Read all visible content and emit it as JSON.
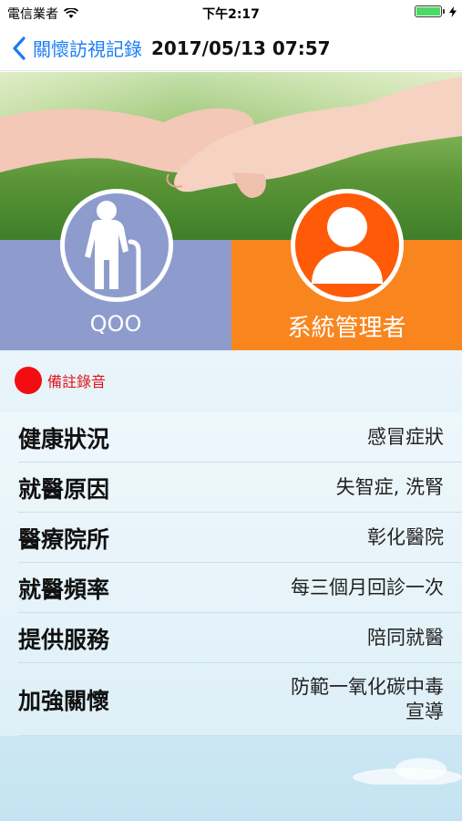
{
  "status_bar": {
    "carrier": "電信業者",
    "time": "下午2:17",
    "wifi_icon": "wifi-icon",
    "battery_color": "#4cd964",
    "battery_level": 1.0
  },
  "nav": {
    "back_label": "關懷訪視記錄",
    "title": "2017/05/13 07:57",
    "accent": "#1a7cf5"
  },
  "profiles": {
    "left": {
      "name": "QOO",
      "icon": "elderly-person-icon",
      "color": "#8d9ccd"
    },
    "right": {
      "name": "系統管理者",
      "icon": "user-icon",
      "color": "#f9851f"
    }
  },
  "record": {
    "label": "備註錄音",
    "color": "#f20d12"
  },
  "info": [
    {
      "key": "健康狀況",
      "value": "感冒症狀"
    },
    {
      "key": "就醫原因",
      "value": "失智症, 洗腎"
    },
    {
      "key": "醫療院所",
      "value": "彰化醫院"
    },
    {
      "key": "就醫頻率",
      "value": "每三個月回診一次"
    },
    {
      "key": "提供服務",
      "value": "陪同就醫"
    },
    {
      "key": "加強關懷",
      "value": "防範一氧化碳中毒\n宣導"
    }
  ]
}
